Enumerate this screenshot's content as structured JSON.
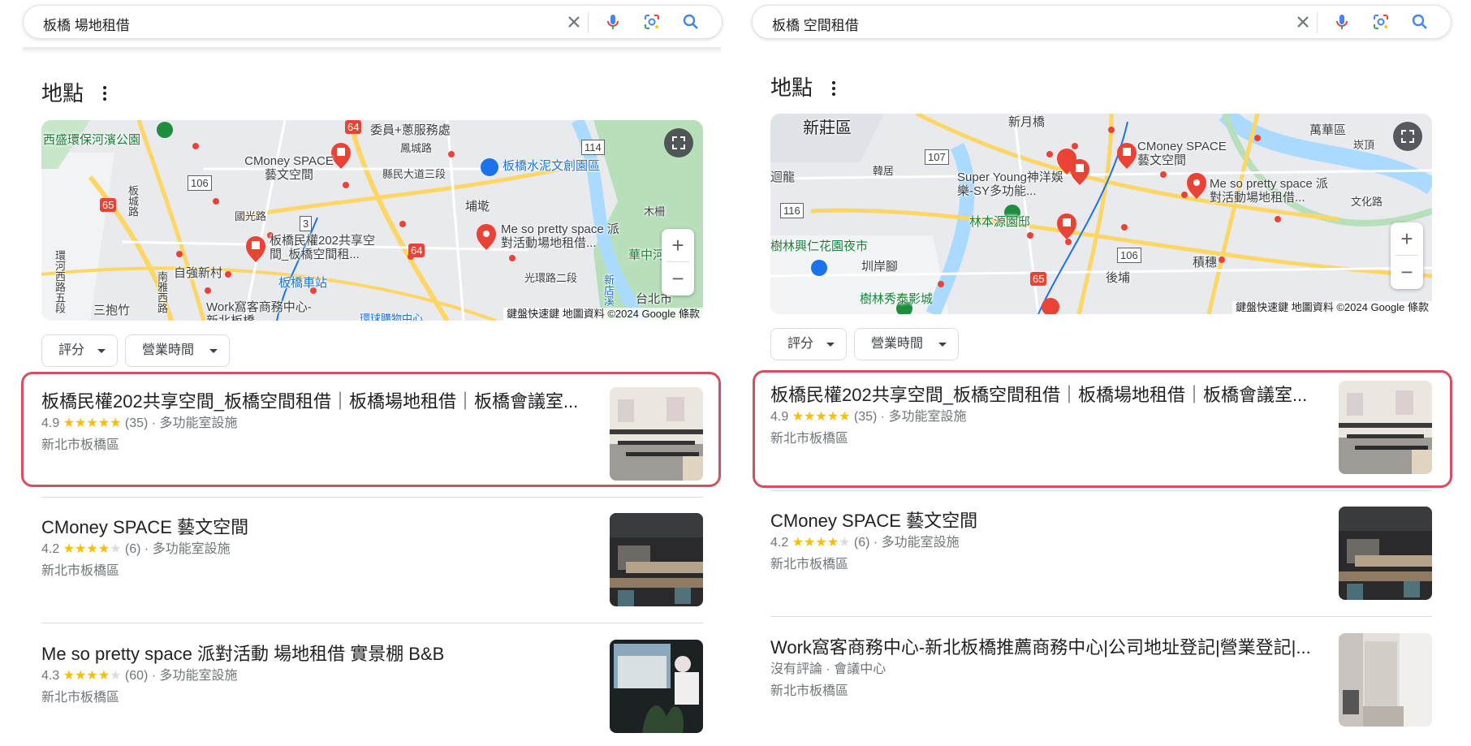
{
  "left": {
    "query": "板橋 場地租借",
    "section_title": "地點",
    "map": {
      "attribution": "鍵盤快速鍵 地圖資料 ©2024 Google 條款",
      "places": [
        {
          "name": "西盛環保河濱公園"
        },
        {
          "name": "委員+蔥服務處"
        },
        {
          "name": "鳳城路"
        },
        {
          "name": "CMoney SPACE 藝文空間"
        },
        {
          "name": "縣民大道三段"
        },
        {
          "name": "板橋水泥文創園區"
        },
        {
          "name": "國光路"
        },
        {
          "name": "埔墘"
        },
        {
          "name": "板橋民權202共享空間_板橋空間租..."
        },
        {
          "name": "Me so pretty space 派對活動場地租借..."
        },
        {
          "name": "自強新村"
        },
        {
          "name": "板橋車站"
        },
        {
          "name": "三抱竹"
        },
        {
          "name": "Work窩客商務中心-新北板橋..."
        },
        {
          "name": "華中河濱"
        },
        {
          "name": "光環路二段"
        },
        {
          "name": "台北市"
        },
        {
          "name": "木柵"
        },
        {
          "name": "環球購物中心"
        },
        {
          "name": "環河西路五段"
        },
        {
          "name": "板城路"
        },
        {
          "name": "南雅西路"
        },
        {
          "name": "新店溪"
        }
      ],
      "route_shields": [
        "64",
        "106",
        "65",
        "3",
        "114",
        "64"
      ]
    },
    "filters": [
      "評分",
      "營業時間"
    ],
    "results": [
      {
        "title": "板橋民權202共享空間_板橋空間租借｜板橋場地租借｜板橋會議室...",
        "rating": "4.9",
        "stars": "★★★★★",
        "stars_empty": "",
        "reviews": "(35)",
        "category": "· 多功能室設施",
        "address": "新北市板橋區"
      },
      {
        "title": "CMoney SPACE 藝文空間",
        "rating": "4.2",
        "stars": "★★★★",
        "stars_empty": "★",
        "reviews": "(6)",
        "category": "· 多功能室設施",
        "address": "新北市板橋區"
      },
      {
        "title": "Me so pretty space 派對活動 場地租借 實景棚 B&B",
        "rating": "4.3",
        "stars": "★★★★",
        "stars_empty": "★",
        "reviews": "(60)",
        "category": "· 多功能室設施",
        "address": "新北市板橋區"
      }
    ]
  },
  "right": {
    "query": "板橋 空間租借",
    "section_title": "地點",
    "map": {
      "attribution": "鍵盤快速鍵 地圖資料 ©2024 Google 條款",
      "places": [
        {
          "name": "新莊區"
        },
        {
          "name": "新月橋"
        },
        {
          "name": "萬華區"
        },
        {
          "name": "CMoney SPACE 藝文空間"
        },
        {
          "name": "Super Young神洋娛樂-SY多功能..."
        },
        {
          "name": "Me so pretty space 派對活動場地租借..."
        },
        {
          "name": "林本源園邸"
        },
        {
          "name": "樹林興仁花園夜市"
        },
        {
          "name": "圳岸腳"
        },
        {
          "name": "積穗"
        },
        {
          "name": "後埔"
        },
        {
          "name": "樹林秀泰影城"
        },
        {
          "name": "迴龍"
        },
        {
          "name": "韓居"
        },
        {
          "name": "文化路"
        },
        {
          "name": "崁頂"
        }
      ],
      "route_shields": [
        "107",
        "116",
        "106",
        "65"
      ]
    },
    "filters": [
      "評分",
      "營業時間"
    ],
    "results": [
      {
        "title": "板橋民權202共享空間_板橋空間租借｜板橋場地租借｜板橋會議室...",
        "rating": "4.9",
        "stars": "★★★★★",
        "stars_empty": "",
        "reviews": "(35)",
        "category": "· 多功能室設施",
        "address": "新北市板橋區"
      },
      {
        "title": "CMoney SPACE 藝文空間",
        "rating": "4.2",
        "stars": "★★★★",
        "stars_empty": "★",
        "reviews": "(6)",
        "category": "· 多功能室設施",
        "address": "新北市板橋區"
      },
      {
        "title": "Work窩客商務中心-新北板橋推薦商務中心|公司地址登記|營業登記|...",
        "rating_text": "沒有評論 · 會議中心",
        "address": "新北市板橋區"
      }
    ]
  },
  "colors": {
    "highlight": "#d64f5e",
    "star": "#fbbc04",
    "pin": "#ea4335",
    "link_blue": "#1a73e8"
  }
}
